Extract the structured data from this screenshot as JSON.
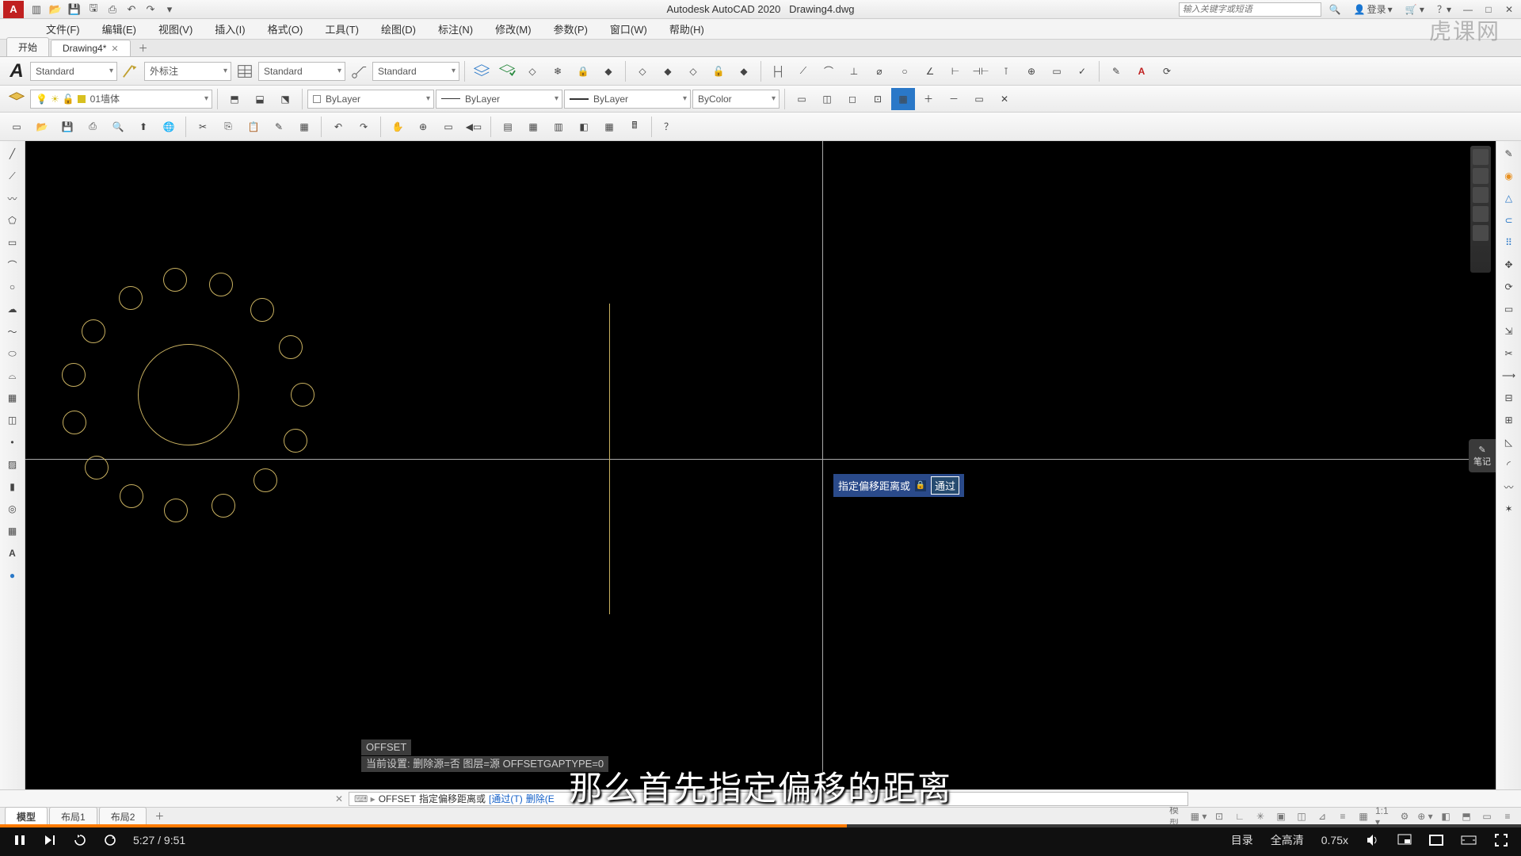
{
  "title": {
    "app": "Autodesk AutoCAD 2020",
    "file": "Drawing4.dwg"
  },
  "search": {
    "placeholder": "输入关键字或短语"
  },
  "user": {
    "login": "登录"
  },
  "menu": [
    "文件(F)",
    "编辑(E)",
    "视图(V)",
    "插入(I)",
    "格式(O)",
    "工具(T)",
    "绘图(D)",
    "标注(N)",
    "修改(M)",
    "参数(P)",
    "窗口(W)",
    "帮助(H)"
  ],
  "tabs": {
    "start": "开始",
    "active": "Drawing4*"
  },
  "ribbon": {
    "textStyle": "Standard",
    "dimStyle": "外标注",
    "tableStyle": "Standard",
    "mleaderStyle": "Standard"
  },
  "layers": {
    "current": "01墙体",
    "linetype": "ByLayer",
    "lineweight": "ByLayer",
    "color": "ByLayer",
    "plot": "ByColor"
  },
  "layout_tabs": {
    "model": "模型",
    "l1": "布局1",
    "l2": "布局2"
  },
  "status_right": {
    "model_btn": "模型"
  },
  "command": {
    "prompt_label": "指定偏移距离或",
    "hist1": "OFFSET",
    "hist2": "当前设置: 删除源=否  图层=源  OFFSETGAPTYPE=0",
    "line_cmd": "OFFSET",
    "line_text": "指定偏移距离或",
    "opt1": "[通过(T)",
    "opt2": "删除(E",
    "tooltip_input": "通过"
  },
  "subtitle": "那么首先指定偏移的距离",
  "notes_icon": "笔记",
  "watermark": "虎课网",
  "player": {
    "time_cur": "5:27",
    "time_total": "9:51",
    "catalog": "目录",
    "quality": "全高清",
    "speed": "0.75x"
  }
}
